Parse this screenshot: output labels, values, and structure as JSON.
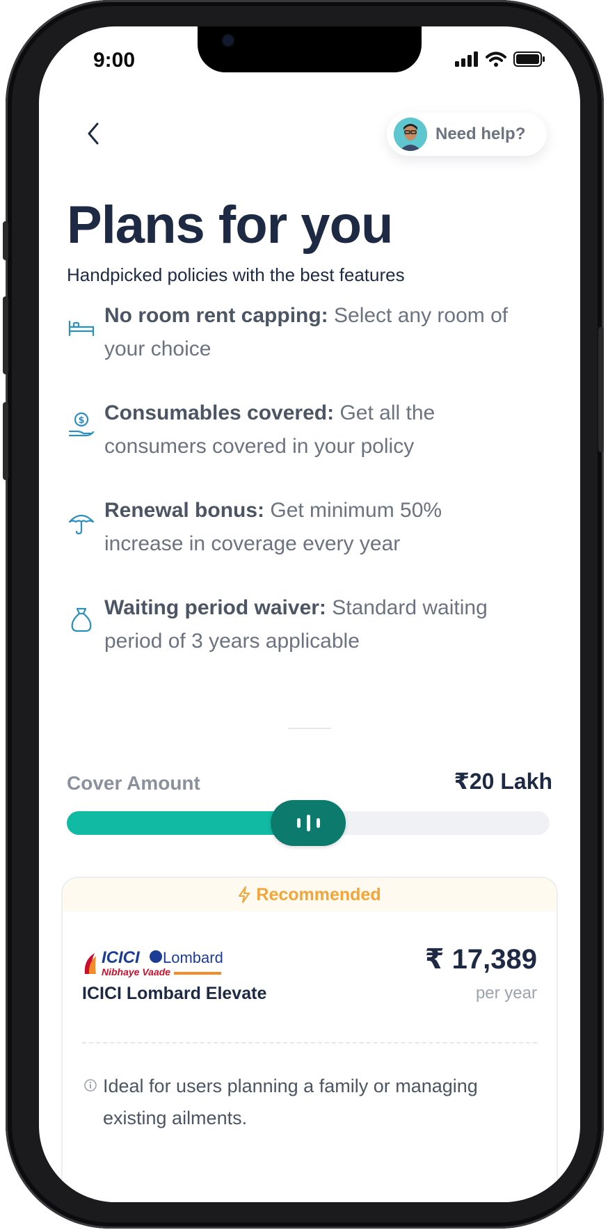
{
  "status_bar": {
    "time": "9:00"
  },
  "header": {
    "help_label": "Need help?"
  },
  "page": {
    "title": "Plans for you",
    "subtitle": "Handpicked policies with the best features"
  },
  "features": [
    {
      "icon": "bed-icon",
      "title": "No room rent capping:",
      "description": " Select any room of your choice"
    },
    {
      "icon": "money-hand-icon",
      "title": "Consumables covered:",
      "description": " Get all the consumers covered in your policy"
    },
    {
      "icon": "umbrella-icon",
      "title": "Renewal bonus:",
      "description": " Get minimum 50% increase in coverage every year"
    },
    {
      "icon": "money-bag-icon",
      "title": "Waiting period waiver:",
      "description": " Standard waiting period of 3 years applicable"
    }
  ],
  "cover": {
    "label": "Cover Amount",
    "value": "₹20 Lakh",
    "slider_fraction": 0.5
  },
  "plan_card": {
    "badge": "Recommended",
    "logo": {
      "brand": "ICICI",
      "brand2": "Lombard",
      "tagline": "Nibhaye Vaade"
    },
    "name": "ICICI Lombard Elevate",
    "price": "₹ 17,389",
    "price_period": "per year",
    "info": "Ideal for users planning a family or managing existing ailments."
  },
  "colors": {
    "accent": "#11bba3",
    "accent_dark": "#0c7a6c",
    "title": "#1e2a44",
    "recommended": "#f2a53a",
    "icon": "#2a8fbd"
  }
}
